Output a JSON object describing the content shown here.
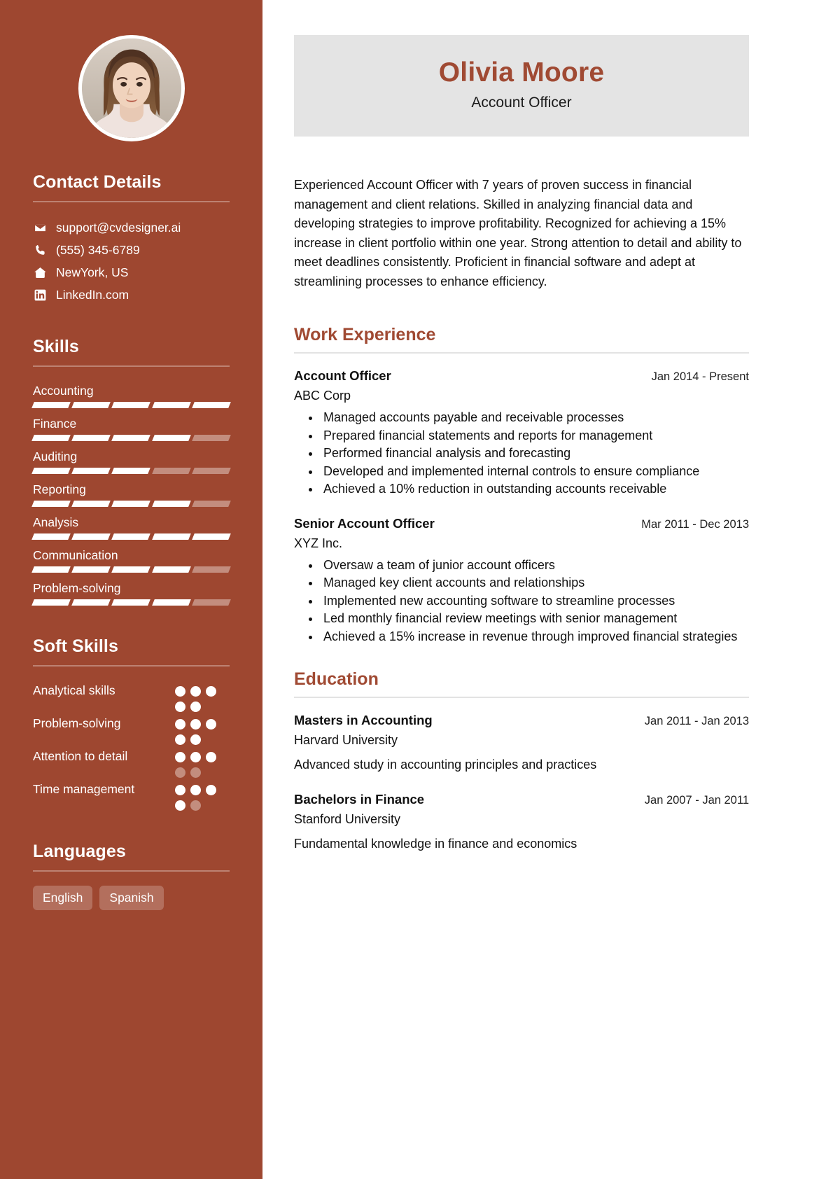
{
  "sidebar": {
    "avatar": {
      "icon": "profile-photo",
      "alt": "profile photo"
    },
    "contact": {
      "heading": "Contact Details",
      "items": [
        {
          "icon": "envelope-icon",
          "label": "support@cvdesigner.ai"
        },
        {
          "icon": "phone-icon",
          "label": "(555) 345-6789"
        },
        {
          "icon": "home-icon",
          "label": "NewYork, US"
        },
        {
          "icon": "linkedin-icon",
          "label": "LinkedIn.com"
        }
      ]
    },
    "skills": {
      "heading": "Skills",
      "max": 5,
      "items": [
        {
          "label": "Accounting",
          "level": 5
        },
        {
          "label": "Finance",
          "level": 4
        },
        {
          "label": "Auditing",
          "level": 3
        },
        {
          "label": "Reporting",
          "level": 4
        },
        {
          "label": "Analysis",
          "level": 5
        },
        {
          "label": "Communication",
          "level": 4
        },
        {
          "label": "Problem-solving",
          "level": 4
        }
      ]
    },
    "soft_skills": {
      "heading": "Soft Skills",
      "max": 5,
      "items": [
        {
          "label": "Analytical skills",
          "level": 5
        },
        {
          "label": "Problem-solving",
          "level": 5
        },
        {
          "label": "Attention to detail",
          "level": 3
        },
        {
          "label": "Time management",
          "level": 4
        }
      ]
    },
    "languages": {
      "heading": "Languages",
      "items": [
        "English",
        "Spanish"
      ]
    }
  },
  "main": {
    "name": "Olivia Moore",
    "role": "Account Officer",
    "summary": "Experienced Account Officer with 7 years of proven success in financial management and client relations. Skilled in analyzing financial data and developing strategies to improve profitability. Recognized for achieving a 15% increase in client portfolio within one year. Strong attention to detail and ability to meet deadlines consistently. Proficient in financial software and adept at streamlining processes to enhance efficiency.",
    "work": {
      "heading": "Work Experience",
      "entries": [
        {
          "title": "Account Officer",
          "date": "Jan 2014 - Present",
          "org": "ABC Corp",
          "bullets": [
            "Managed accounts payable and receivable processes",
            "Prepared financial statements and reports for management",
            "Performed financial analysis and forecasting",
            "Developed and implemented internal controls to ensure compliance",
            "Achieved a 10% reduction in outstanding accounts receivable"
          ]
        },
        {
          "title": "Senior Account Officer",
          "date": "Mar 2011 - Dec 2013",
          "org": "XYZ Inc.",
          "bullets": [
            "Oversaw a team of junior account officers",
            "Managed key client accounts and relationships",
            "Implemented new accounting software to streamline processes",
            "Led monthly financial review meetings with senior management",
            "Achieved a 15% increase in revenue through improved financial strategies"
          ]
        }
      ]
    },
    "education": {
      "heading": "Education",
      "entries": [
        {
          "title": "Masters in Accounting",
          "date": "Jan 2011 - Jan 2013",
          "org": "Harvard University",
          "desc": "Advanced study in accounting principles and practices"
        },
        {
          "title": "Bachelors in Finance",
          "date": "Jan 2007 - Jan 2011",
          "org": "Stanford University",
          "desc": "Fundamental knowledge in finance and economics"
        }
      ]
    }
  },
  "colors": {
    "accent": "#9e4730",
    "heading_accent": "#a04a33",
    "name_card_bg": "#e4e4e4",
    "sidebar_bg": "#9e4730",
    "text": "#111111"
  }
}
